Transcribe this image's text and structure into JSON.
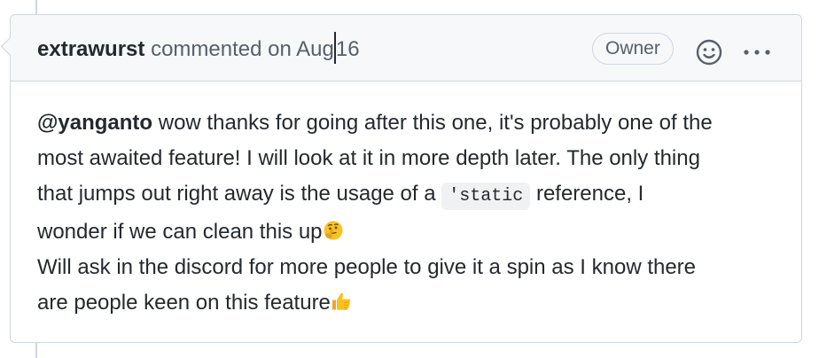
{
  "comment": {
    "author": "extrawurst",
    "action_text": "commented on",
    "date_part1": "Aug",
    "date_part2": "16",
    "role_badge": "Owner"
  },
  "body": {
    "mention": "@yanganto",
    "line1_rest": " wow thanks for going after this one, it's probably one of the",
    "line2": "most awaited feature! I will look at it in more depth later. The only thing",
    "line3_before_code": "that jumps out right away is the usage of a ",
    "code": "'static",
    "line3_after_code": " reference, I",
    "line4": "wonder if we can clean this up",
    "line5": "Will ask in the discord for more people to give it a spin as I know there",
    "line6": "are people keen on this feature"
  },
  "icons": {
    "emoji_reaction": "smiley-icon",
    "more_options": "kebab-horizontal-icon",
    "thinking": "thinking-face-emoji",
    "thumbs_up": "thumbs-up-emoji"
  }
}
